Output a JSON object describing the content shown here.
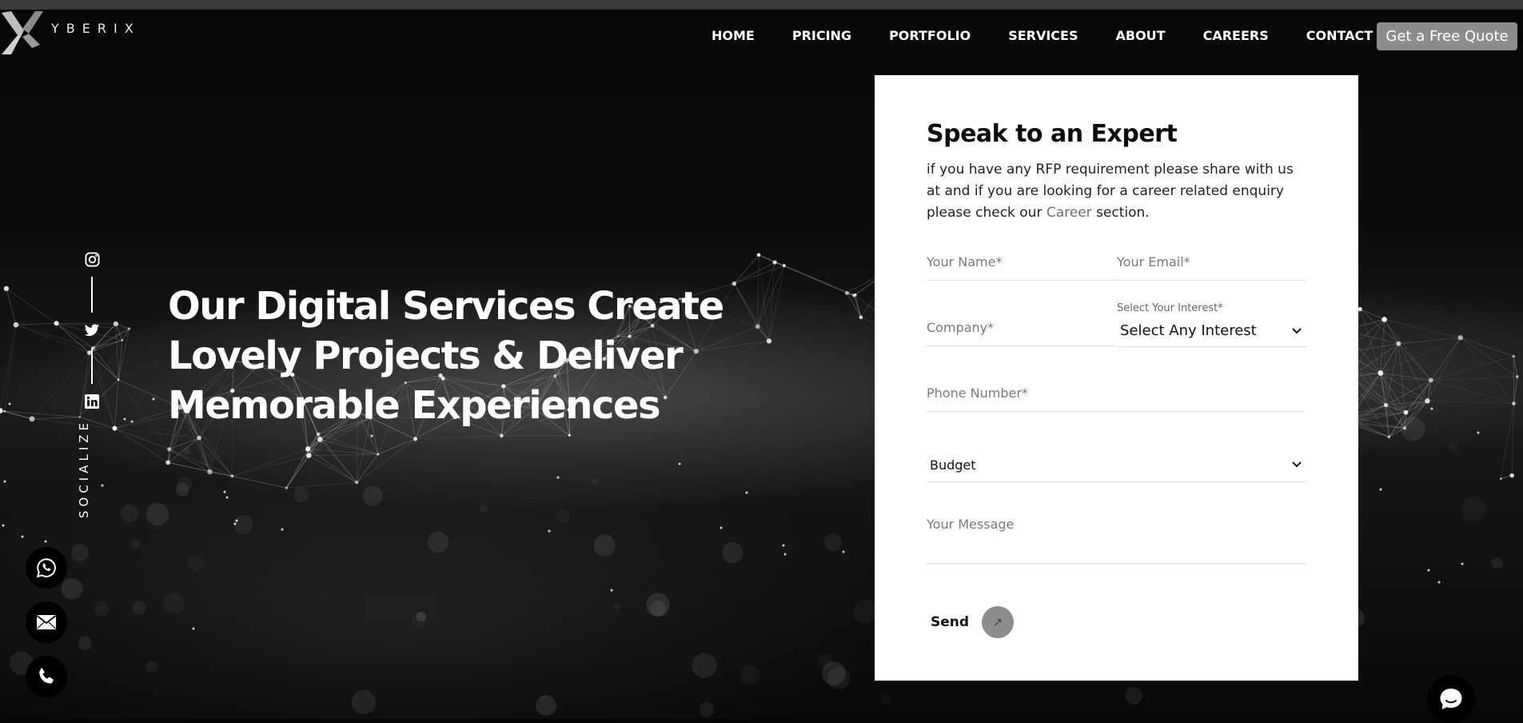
{
  "logo": {
    "text": "YBERIX"
  },
  "nav": {
    "items": [
      "HOME",
      "PRICING",
      "PORTFOLIO",
      "SERVICES",
      "ABOUT",
      "CAREERS",
      "CONTACT"
    ],
    "cta": "Get a Free Quote"
  },
  "social": {
    "label": "SOCIALIZE",
    "icons": [
      "instagram-icon",
      "twitter-icon",
      "linkedin-icon"
    ]
  },
  "hero": {
    "headline": "Our Digital Services Create Lovely Projects & Deliver Memorable Experiences"
  },
  "floating": {
    "icons": [
      "whatsapp-icon",
      "email-icon",
      "phone-icon",
      "chat-icon"
    ]
  },
  "form": {
    "title": "Speak to an Expert",
    "desc_before": "if you have any RFP requirement please share with us at and if you are looking for a career related enquiry please check our ",
    "desc_link": "Career",
    "desc_after": " section.",
    "name_placeholder": "Your Name*",
    "email_placeholder": "Your Email*",
    "company_placeholder": "Company*",
    "interest_label": "Select Your Interest*",
    "interest_value": "Select Any Interest",
    "phone_placeholder": "Phone Number*",
    "budget_value": "Budget",
    "message_placeholder": "Your Message",
    "send_label": "Send"
  },
  "colors": {
    "background": "#050505",
    "card": "#ffffff",
    "cta": "#8c8c8c",
    "link": "#6e6e6e",
    "send_button": "#8d8d8d"
  }
}
